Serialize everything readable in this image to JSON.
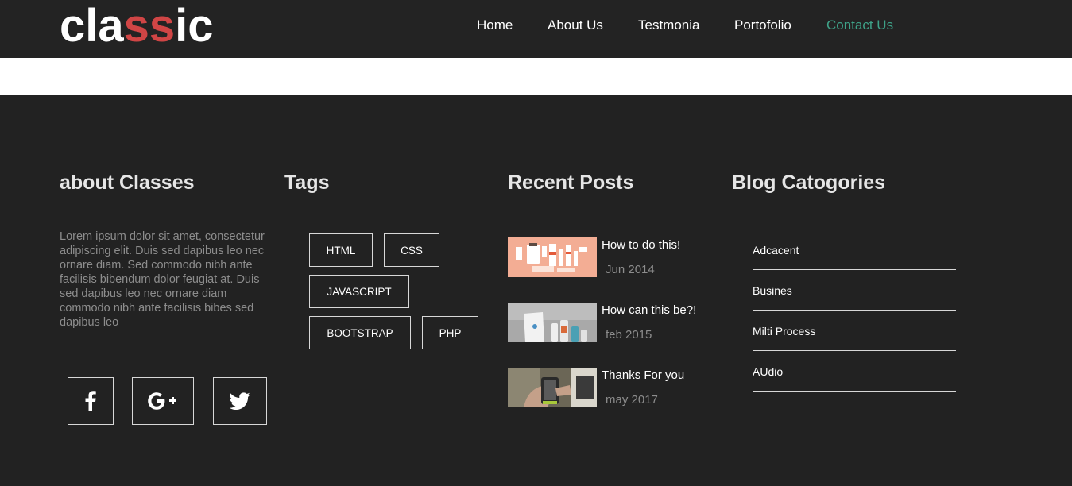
{
  "header": {
    "logo_prefix": "cla",
    "logo_accent": "ss",
    "logo_suffix": "ic",
    "nav": [
      {
        "label": "Home"
      },
      {
        "label": "About Us"
      },
      {
        "label": "Testmonia"
      },
      {
        "label": "Portofolio"
      },
      {
        "label": "Contact Us",
        "active": true
      }
    ]
  },
  "footer": {
    "about": {
      "heading": "about Classes",
      "text": "Lorem ipsum dolor sit amet, consectetur adipiscing elit. Duis sed dapibus leo nec ornare diam. Sed commodo nibh ante facilisis bibendum dolor feugiat at. Duis sed dapibus leo nec ornare diam commodo nibh ante facilisis bibes sed dapibus leo",
      "social": [
        {
          "icon": "facebook-icon"
        },
        {
          "icon": "google-plus-icon"
        },
        {
          "icon": "twitter-icon"
        }
      ]
    },
    "tags": {
      "heading": "Tags",
      "items": [
        "HTML",
        "CSS",
        "JAVASCRIPT",
        "BOOTSTRAP",
        "PHP"
      ]
    },
    "recent_posts": {
      "heading": "Recent Posts",
      "items": [
        {
          "title": "How to do this!",
          "date": "Jun 2014"
        },
        {
          "title": "How can this be?!",
          "date": "feb 2015"
        },
        {
          "title": "Thanks For you",
          "date": "may 2017"
        }
      ]
    },
    "categories": {
      "heading": "Blog Catogories",
      "items": [
        "Adcacent",
        "Busines",
        "Milti Process",
        "AUdio"
      ]
    }
  },
  "colors": {
    "background": "#222222",
    "accent_red": "#d04545",
    "accent_green": "#3ea288",
    "text_muted": "#8d8d8d"
  }
}
